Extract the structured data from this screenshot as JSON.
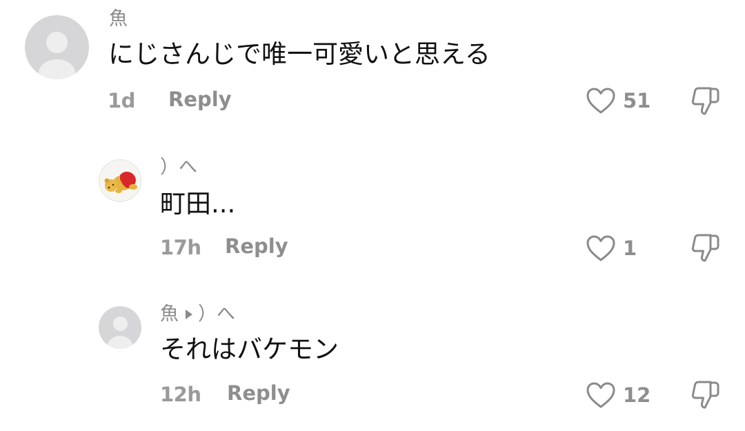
{
  "comments": [
    {
      "username": "魚",
      "text": "にじさんじで唯一可愛いと思える",
      "timestamp": "1d",
      "reply_label": "Reply",
      "likes": "51",
      "avatar_icon": "default-avatar-icon"
    },
    {
      "username": "）へ",
      "text": "町田...",
      "timestamp": "17h",
      "reply_label": "Reply",
      "likes": "1",
      "avatar_icon": "winnie-the-pooh-avatar"
    },
    {
      "username": "魚",
      "reply_to": "）へ",
      "text": "それはバケモン",
      "timestamp": "12h",
      "reply_label": "Reply",
      "likes": "12",
      "avatar_icon": "default-avatar-icon"
    }
  ],
  "colors": {
    "text": "#111111",
    "meta": "#8e8e8e",
    "icon_stroke": "#8a8a8a",
    "avatar_bg": "#d6d6d8"
  }
}
